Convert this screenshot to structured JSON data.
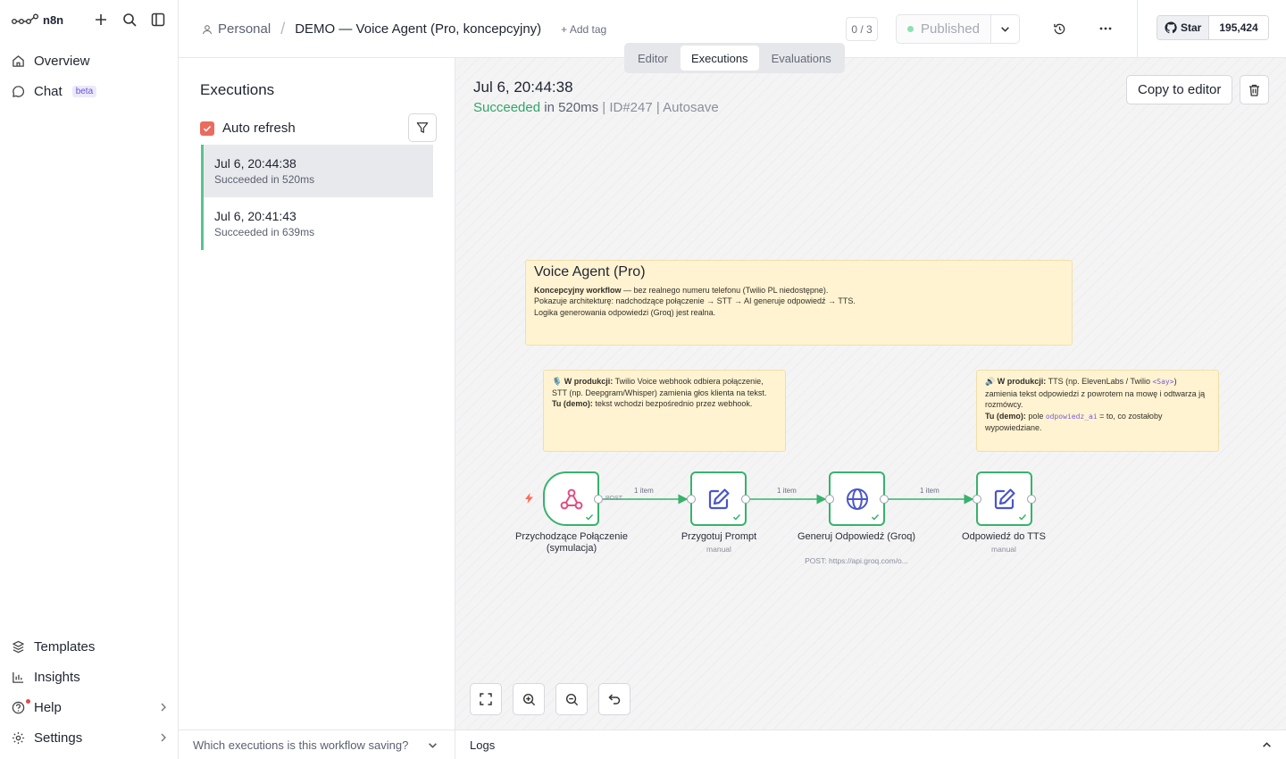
{
  "brand": {
    "name": "n8n"
  },
  "sidebar": {
    "top": [
      {
        "label": "Overview",
        "icon": "home-icon"
      },
      {
        "label": "Chat",
        "badge": "beta",
        "icon": "chat-icon"
      }
    ],
    "bottom": [
      {
        "label": "Templates",
        "icon": "templates-icon"
      },
      {
        "label": "Insights",
        "icon": "insights-icon"
      },
      {
        "label": "Help",
        "icon": "help-icon"
      },
      {
        "label": "Settings",
        "icon": "settings-icon"
      }
    ]
  },
  "header": {
    "project": "Personal",
    "workflow_title": "DEMO — Voice Agent (Pro, koncepcyjny)",
    "add_tag": "+ Add tag",
    "counter": "0 / 3",
    "published": "Published",
    "github": {
      "star": "Star",
      "count": "195,424"
    }
  },
  "tabs": [
    "Editor",
    "Executions",
    "Evaluations"
  ],
  "active_tab": "Executions",
  "executions": {
    "title": "Executions",
    "auto_refresh": "Auto refresh",
    "items": [
      {
        "date": "Jul 6, 20:44:38",
        "status": "Succeeded in 520ms"
      },
      {
        "date": "Jul 6, 20:41:43",
        "status": "Succeeded in 639ms"
      }
    ],
    "saving_question": "Which executions is this workflow saving?"
  },
  "run": {
    "date": "Jul 6, 20:44:38",
    "status": "Succeeded",
    "duration": " in 520ms",
    "id": " | ID#247 | ",
    "mode": "Autosave",
    "copy_to_editor": "Copy to editor"
  },
  "stickies": {
    "main": {
      "title": "Voice Agent (Pro)",
      "l1_bold": "Koncepcyjny workflow",
      "l1_rest": " — bez realnego numeru telefonu (Twilio PL niedostępne).",
      "l2": "Pokazuje architekturę: nadchodzące połączenie → STT → AI generuje odpowiedź → TTS.",
      "l3": "Logika generowania odpowiedzi (Groq) jest realna."
    },
    "a": {
      "emoji": "🎙️",
      "prod_label": "W produkcji:",
      "prod_text": " Twilio Voice webhook odbiera połączenie, STT (np. Deepgram/Whisper) zamienia głos klienta na tekst.",
      "demo_label": "Tu (demo):",
      "demo_text": " tekst wchodzi bezpośrednio przez webhook."
    },
    "b": {
      "emoji": "🔊",
      "prod_label": "W produkcji:",
      "prod_text": " TTS (np. ElevenLabs / Twilio ",
      "prod_code": "<Say>",
      "prod_text2": ") zamienia tekst odpowiedzi z powrotem na mowę i odtwarza ją rozmówcy.",
      "demo_label": "Tu (demo):",
      "demo_text": " pole ",
      "demo_code": "odpowiedz_ai",
      "demo_text2": " = to, co zostałoby wypowiedziane."
    }
  },
  "nodes": [
    {
      "name": "Przychodzące Połączenie (symulacja)",
      "sub": "",
      "icon": "webhook-icon"
    },
    {
      "name": "Przygotuj Prompt",
      "sub": "manual",
      "icon": "edit-icon"
    },
    {
      "name": "Generuj Odpowiedź (Groq)",
      "sub": "POST: https://api.groq.com/o...",
      "icon": "globe-icon"
    },
    {
      "name": "Odpowiedź do TTS",
      "sub": "manual",
      "icon": "edit-icon"
    }
  ],
  "edges": [
    "1 item",
    "1 item",
    "1 item"
  ],
  "post_label": "POST",
  "logs": "Logs",
  "colors": {
    "success": "#37b26c",
    "accent": "#ea6c5e",
    "sticky": "#fff3d1"
  }
}
